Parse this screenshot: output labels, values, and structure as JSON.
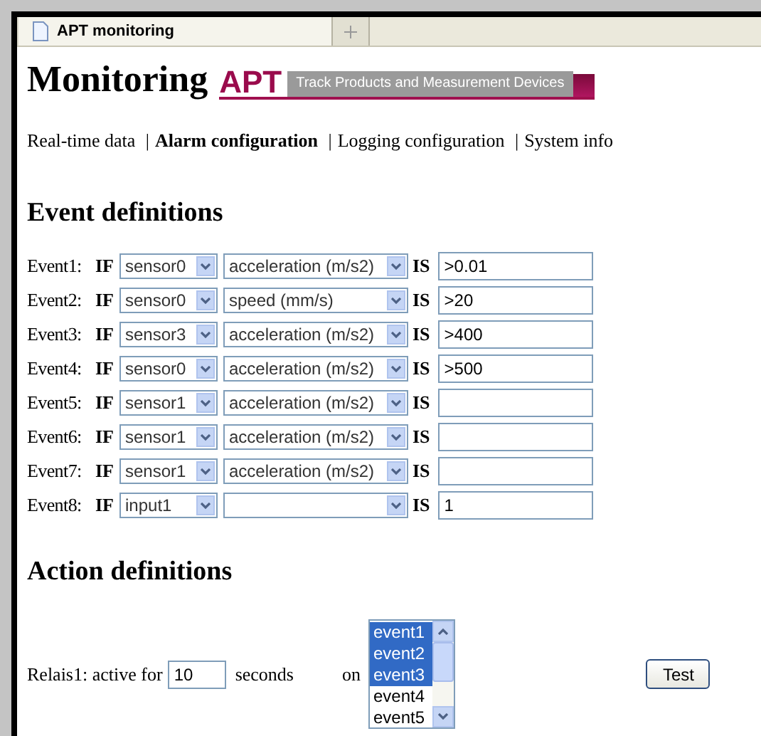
{
  "browser_tab": {
    "title": "APT monitoring"
  },
  "page": {
    "title": "Monitoring",
    "logo": {
      "mark": "APT",
      "tagline": "Track Products and Measurement Devices"
    }
  },
  "nav": {
    "items": [
      {
        "label": "Real-time data",
        "selected": false
      },
      {
        "label": "Alarm configuration",
        "selected": true
      },
      {
        "label": "Logging configuration",
        "selected": false
      },
      {
        "label": "System info",
        "selected": false
      }
    ],
    "separators": [
      "|",
      "|",
      "|"
    ]
  },
  "event_definitions": {
    "heading": "Event definitions",
    "events": [
      {
        "label": "Event1:",
        "if": "IF",
        "source": "sensor0",
        "quantity": "acceleration (m/s2)",
        "is": "IS",
        "value": ">0.01"
      },
      {
        "label": "Event2:",
        "if": "IF",
        "source": "sensor0",
        "quantity": "speed (mm/s)",
        "is": "IS",
        "value": ">20"
      },
      {
        "label": "Event3:",
        "if": "IF",
        "source": "sensor3",
        "quantity": "acceleration (m/s2)",
        "is": "IS",
        "value": ">400"
      },
      {
        "label": "Event4:",
        "if": "IF",
        "source": "sensor0",
        "quantity": "acceleration (m/s2)",
        "is": "IS",
        "value": ">500"
      },
      {
        "label": "Event5:",
        "if": "IF",
        "source": "sensor1",
        "quantity": "acceleration (m/s2)",
        "is": "IS"
      },
      {
        "label": "Event6:",
        "if": "IF",
        "source": "sensor1",
        "quantity": "acceleration (m/s2)",
        "is": "IS"
      },
      {
        "label": "Event7:",
        "if": "IF",
        "source": "sensor1",
        "quantity": "acceleration (m/s2)",
        "is": "IS"
      },
      {
        "label": "Event8:",
        "if": "IF",
        "source": "input1",
        "is": "IS",
        "value": "1"
      }
    ]
  },
  "action_definitions": {
    "heading": "Action definitions",
    "relais": {
      "label": "Relais1: active for",
      "duration": "10",
      "unit": "seconds",
      "on": "on",
      "events": [
        {
          "label": "event1",
          "selected": true
        },
        {
          "label": "event2",
          "selected": true
        },
        {
          "label": "event3",
          "selected": true
        },
        {
          "label": "event4",
          "selected": false
        },
        {
          "label": "event5",
          "selected": false
        }
      ],
      "button": "Test"
    }
  }
}
